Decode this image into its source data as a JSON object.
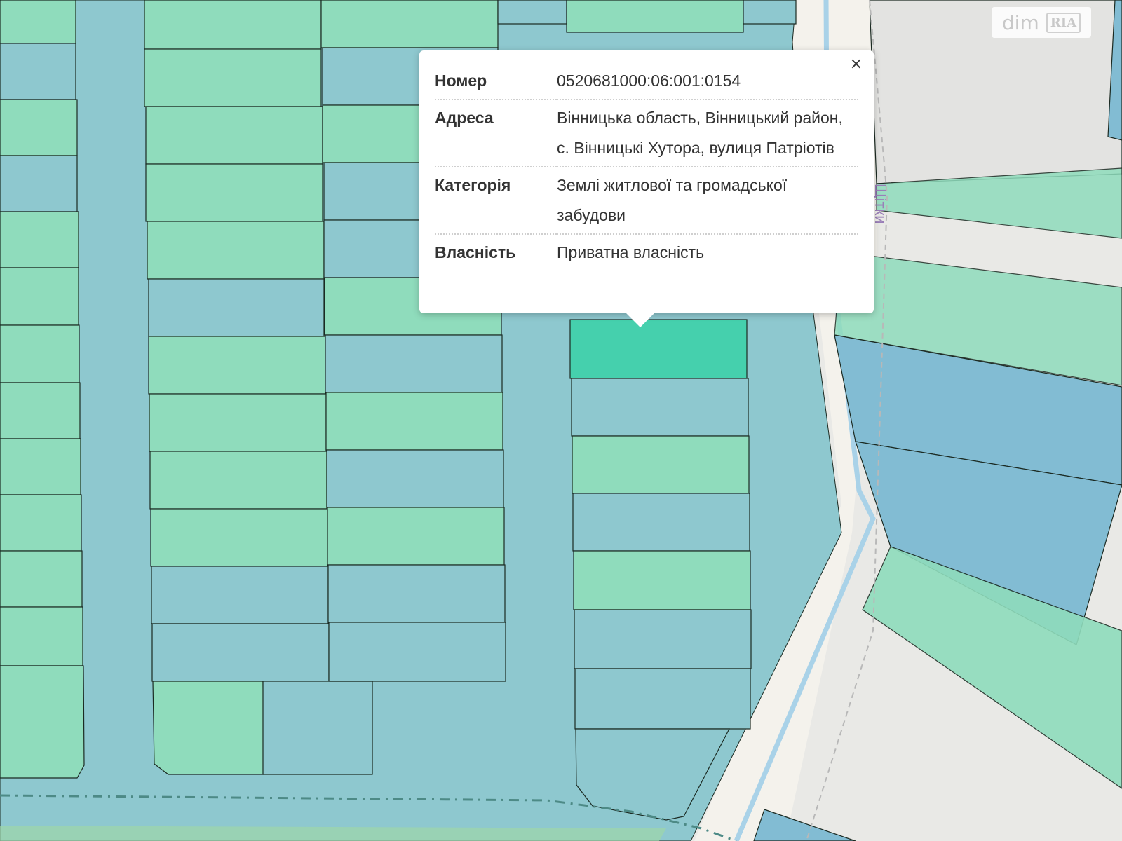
{
  "popup": {
    "close_label": "×",
    "rows": [
      {
        "label": "Номер",
        "value": "0520681000:06:001:0154"
      },
      {
        "label": "Адреса",
        "value": "Вінницька область, Вінницький район, с. Вінницькі Хутора, вулиця Патріотів"
      },
      {
        "label": "Категорія",
        "value": "Землі житлової та громадської забудови"
      },
      {
        "label": "Власність",
        "value": "Приватна власність"
      }
    ]
  },
  "map": {
    "street_label": "Щітки",
    "colors": {
      "background": "#e9e9e6",
      "parcel_green": "#8fdcbc",
      "parcel_blue": "#8ec8cf",
      "parcel_selected": "#45d0ad",
      "parcel_dark_blue": "#82bcd3",
      "road_white": "#f4f2ec",
      "stream": "#a9d2e8",
      "border": "#1b2a22"
    }
  },
  "watermark": {
    "text_dim": "dim",
    "text_ria": "RIA"
  }
}
